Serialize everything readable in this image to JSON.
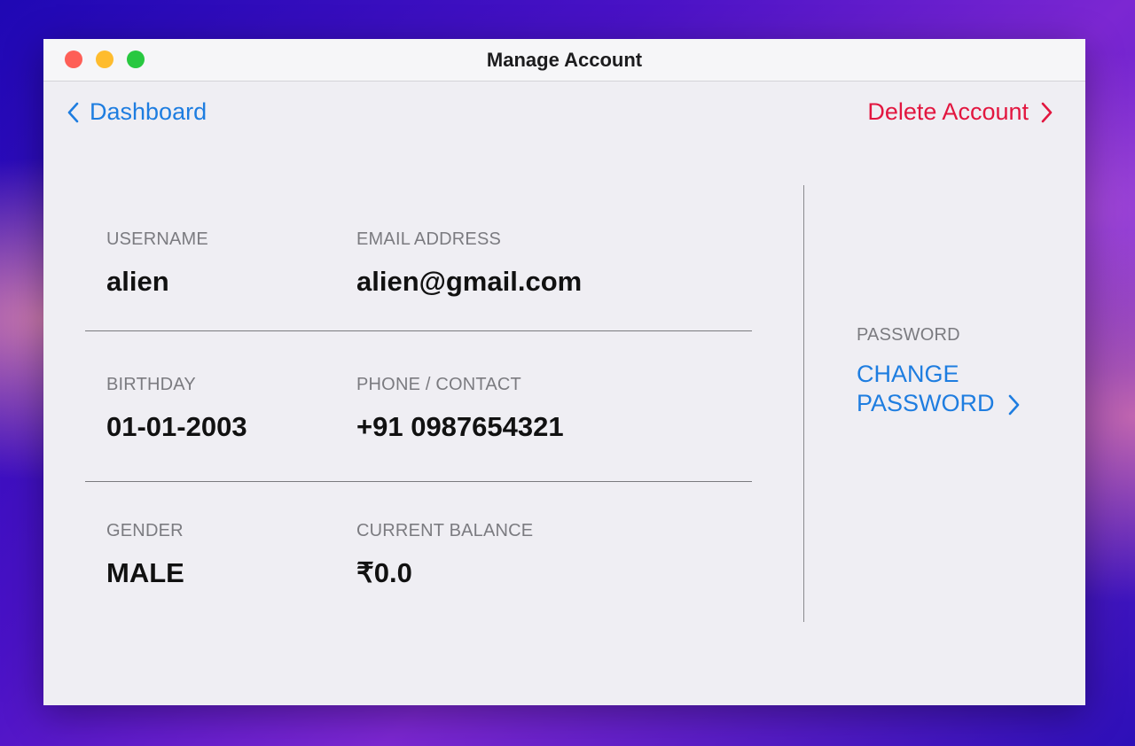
{
  "window": {
    "title": "Manage Account"
  },
  "nav": {
    "back_label": "Dashboard",
    "delete_label": "Delete Account"
  },
  "fields": {
    "username": {
      "label": "USERNAME",
      "value": "alien"
    },
    "email": {
      "label": "EMAIL ADDRESS",
      "value": "alien@gmail.com"
    },
    "birthday": {
      "label": "BIRTHDAY",
      "value": "01-01-2003"
    },
    "phone": {
      "label": "PHONE / CONTACT",
      "value": "+91 0987654321"
    },
    "gender": {
      "label": "GENDER",
      "value": "MALE"
    },
    "balance": {
      "label": "CURRENT BALANCE",
      "value": "₹0.0"
    }
  },
  "password": {
    "label": "PASSWORD",
    "change_line1": "CHANGE",
    "change_line2": "PASSWORD"
  },
  "colors": {
    "link": "#1e7de0",
    "danger": "#e2163f",
    "window_bg": "#efeef3"
  },
  "icons": {
    "back": "chevron-left-icon",
    "forward": "chevron-right-icon"
  }
}
